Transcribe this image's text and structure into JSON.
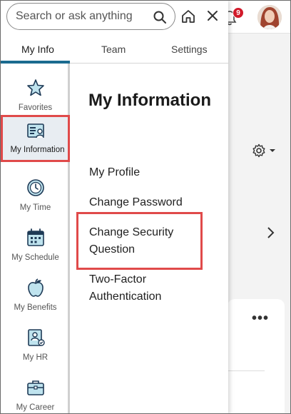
{
  "search": {
    "placeholder": "Search or ask anything"
  },
  "notifications": {
    "count": "9"
  },
  "tabs": [
    {
      "label": "My Info",
      "active": true
    },
    {
      "label": "Team",
      "active": false
    },
    {
      "label": "Settings",
      "active": false
    }
  ],
  "sidebar": {
    "items": [
      {
        "label": "Favorites",
        "icon": "star-icon"
      },
      {
        "label": "My Information",
        "icon": "id-card-icon",
        "active": true
      },
      {
        "label": "My Time",
        "icon": "clock-icon"
      },
      {
        "label": "My Schedule",
        "icon": "calendar-icon"
      },
      {
        "label": "My Benefits",
        "icon": "apple-icon"
      },
      {
        "label": "My HR",
        "icon": "hr-profile-icon"
      },
      {
        "label": "My Career",
        "icon": "briefcase-icon"
      }
    ]
  },
  "content": {
    "title": "My Information",
    "links": [
      {
        "label": "My Profile"
      },
      {
        "label": "Change Password"
      },
      {
        "label": "Change Security Question"
      },
      {
        "label": "Two-Factor Authentication"
      }
    ]
  },
  "colors": {
    "accent": "#1b6b8f",
    "highlight": "#e04a4a",
    "badge": "#d11a2a"
  }
}
